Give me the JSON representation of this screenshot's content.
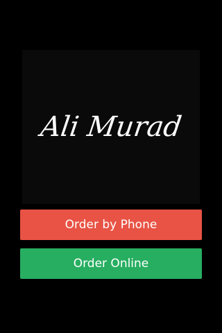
{
  "logo": {
    "text": "Ali Murad"
  },
  "buttons": {
    "order_by_phone": "Order by Phone",
    "order_online": "Order Online"
  },
  "colors": {
    "background": "#000000",
    "logo_panel": "#0a0a0a",
    "order_by_phone_bg": "#e85345",
    "order_online_bg": "#27ae60",
    "text": "#ffffff"
  }
}
